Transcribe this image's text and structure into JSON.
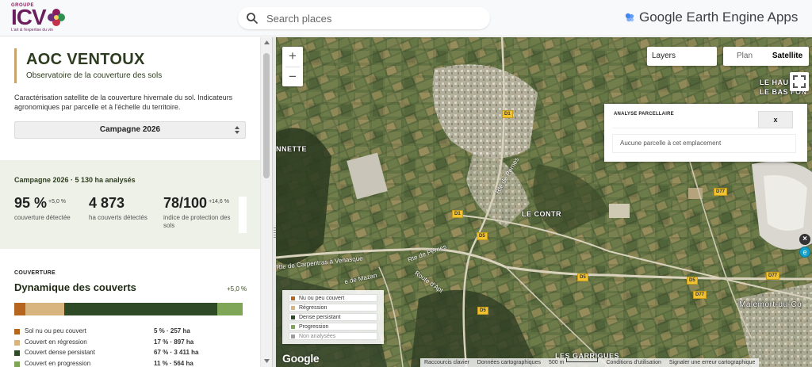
{
  "header": {
    "logo": {
      "groupe": "GROUPE",
      "brand": "ICV",
      "tagline": "L'art & l'expertise du vin"
    },
    "search": {
      "placeholder": "Search places"
    },
    "app_title": "Google Earth Engine Apps"
  },
  "sidebar": {
    "title": "AOC VENTOUX",
    "subtitle": "Observatoire de la couverture des sols",
    "description": "Caractérisation satellite de la couverture hivernale du sol. Indicateurs agronomiques par parcelle et à l'échelle du territoire.",
    "campaign_select": "Campagne 2026",
    "kpi_header": "Campagne 2026 · 5 130 ha analysés",
    "kpis": [
      {
        "value": "95 %",
        "delta": "+5,0 %",
        "label": "couverture détectée"
      },
      {
        "value": "4 873",
        "delta": "",
        "label": "ha couverts détectés"
      },
      {
        "value": "78/100",
        "delta": "+14,6 %",
        "label": "indice de protection des sols"
      }
    ],
    "coverage": {
      "section": "COUVERTURE",
      "title": "Dynamique des couverts",
      "delta": "+5,0 %",
      "segments": [
        {
          "name": "Sol nu ou peu couvert",
          "share": 5,
          "color": "#b5651d"
        },
        {
          "name": "Couvert en régression",
          "share": 17,
          "color": "#d8b57e"
        },
        {
          "name": "Couvert dense persistant",
          "share": 67,
          "color": "#2e4a26"
        },
        {
          "name": "Couvert en progression",
          "share": 11,
          "color": "#7fa657"
        }
      ],
      "rows": [
        {
          "name": "Sol nu ou peu couvert",
          "value": "5 % · 257 ha",
          "color": "#b5651d"
        },
        {
          "name": "Couvert en régression",
          "value": "17 % · 897 ha",
          "color": "#d8b57e"
        },
        {
          "name": "Couvert dense persistant",
          "value": "67 % · 3 411 ha",
          "color": "#2e4a26"
        },
        {
          "name": "Couvert en progression",
          "value": "11 % · 564 ha",
          "color": "#7fa657"
        }
      ]
    }
  },
  "map": {
    "zoom_in": "+",
    "zoom_out": "−",
    "layers_label": "Layers",
    "type_plan": "Plan",
    "type_satellite": "Satellite",
    "analyse": {
      "title": "ANALYSE PARCELLAIRE",
      "close": "x",
      "message": "Aucune parcelle à cet emplacement"
    },
    "legend": [
      {
        "name": "Nu ou peu couvert",
        "color": "#b5651d"
      },
      {
        "name": "Régression",
        "color": "#d8b57e"
      },
      {
        "name": "Dense persistant",
        "color": "#2e4a26"
      },
      {
        "name": "Progression",
        "color": "#7fa657"
      },
      {
        "name": "Non analysées",
        "color": "#9e9e9e"
      }
    ],
    "places": {
      "le_contres": "LE CONTR",
      "nnette": "NNETTE",
      "le_hau": "LE HAU",
      "le_bas_fon": "LE BAS FON",
      "malemort": "Malemort-du-Co",
      "les_garrigues": "LES GARRIGUES"
    },
    "roads": {
      "carpentras": "Rte de Carpentras à Venasque",
      "penes1": "Rte de Pernes",
      "penes2": "Rte de Pernes",
      "mazan": "e de Mazan",
      "apt": "Route d'Apt",
      "d1a": "D1",
      "d1b": "D1",
      "d5a": "D5",
      "d5b": "D5",
      "d5c": "D5",
      "d5d": "D5",
      "d77a": "D77",
      "d77b": "D77",
      "d77c": "D77"
    },
    "google": "Google",
    "attribution": {
      "shortcuts": "Raccourcis clavier",
      "data": "Données cartographiques",
      "scale": "500 m",
      "terms": "Conditions d'utilisation",
      "report": "Signaler une erreur cartographique"
    }
  }
}
